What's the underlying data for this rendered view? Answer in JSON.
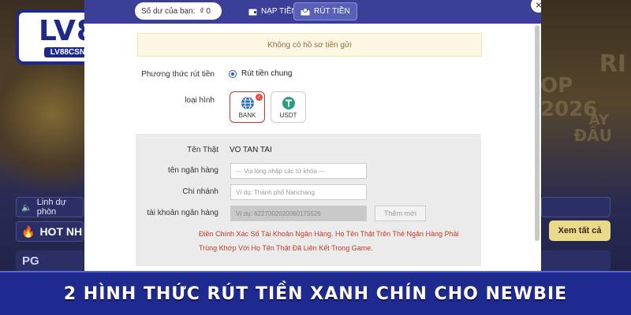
{
  "logo": {
    "brand": "LV88",
    "domain": "LV88CSN.COM"
  },
  "background": {
    "announcement": "Linh dự phòn",
    "hot_label": "HOT NH",
    "see_all": "Xem tất cả",
    "pg_label": "PG",
    "right_text_1": "RI",
    "right_text_2": "OP 2026",
    "right_text_3": "AY",
    "right_text_4": "ĐẦU"
  },
  "modal": {
    "balance_label": "Số dư của bạn:",
    "balance_value": "₫ 0",
    "tabs": [
      {
        "label": "NẠP TIỀN",
        "icon": "wallet-icon"
      },
      {
        "label": "RÚT TIỀN",
        "icon": "withdraw-icon"
      }
    ],
    "close": "×",
    "notice": "Không có hồ sơ tiền gửi",
    "method_label": "Phương thức rút tiền",
    "method_option": "Rút tiền chung",
    "type_label": "loại hình",
    "types": [
      {
        "label": "BANK",
        "icon": "globe-bank-icon",
        "selected": true
      },
      {
        "label": "USDT",
        "icon": "tether-icon",
        "selected": false
      }
    ],
    "form": {
      "real_name_label": "Tên Thật",
      "real_name_value": "VO TAN TAI",
      "bank_name_label": "tên ngân hàng",
      "bank_name_placeholder": "--- Vui lòng nhập các từ khóa ---",
      "branch_label": "Chi nhánh",
      "branch_placeholder": "Ví dụ: Thành phố Nanchang",
      "account_label": "tài khoản ngân hàng",
      "account_placeholder": "Ví dụ: 6227002020060175526",
      "add_button": "Thêm mới",
      "warning": "Điền Chính Xác Số Tài Khoản Ngân Hàng. Họ Tên Thật Trên Thẻ Ngân Hàng Phải Trùng Khớp Với Họ Tên Thật Đã Liên Kết Trong Game."
    }
  },
  "banner": {
    "text": "2 HÌNH THỨC RÚT TIỀN XANH CHÍN CHO NEWBIE"
  },
  "colors": {
    "brand_blue": "#1f2a8f",
    "modal_header": "#3b3f97",
    "warning_red": "#c0392b",
    "notice_bg": "#fcf7e3"
  }
}
